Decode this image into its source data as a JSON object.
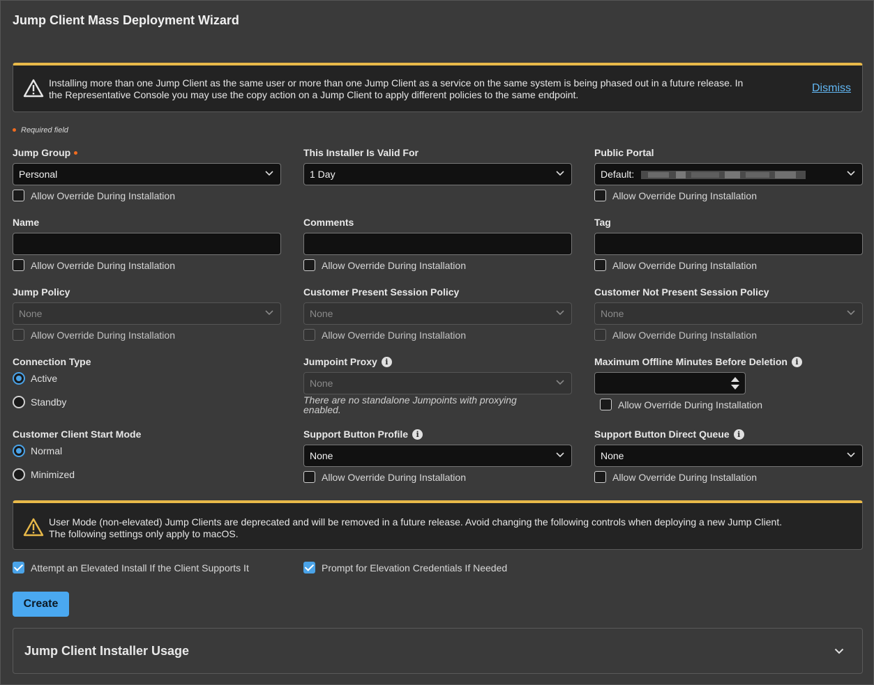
{
  "page": {
    "title": "Jump Client Mass Deployment Wizard"
  },
  "notices": {
    "top": {
      "line1": "Installing more than one Jump Client as the same user or more than one Jump Client as a service on the same system is being phased out in a future release. In",
      "line2": "the Representative Console you may use the copy action on a Jump Client to apply different policies to the same endpoint.",
      "dismiss": "Dismiss"
    },
    "bottom": {
      "line1": "User Mode (non-elevated) Jump Clients are deprecated and will be removed in a future release. Avoid changing the following controls when deploying a new Jump Client.",
      "line2": "The following settings only apply to macOS."
    }
  },
  "required_note": "Required field",
  "override_label": "Allow Override During Installation",
  "fields": {
    "jump_group": {
      "label": "Jump Group",
      "value": "Personal"
    },
    "valid_for": {
      "label": "This Installer Is Valid For",
      "value": "1 Day"
    },
    "public_portal": {
      "label": "Public Portal",
      "value": "Default:"
    },
    "name": {
      "label": "Name"
    },
    "comments": {
      "label": "Comments"
    },
    "tag": {
      "label": "Tag"
    },
    "jump_policy": {
      "label": "Jump Policy",
      "value": "None"
    },
    "present_policy": {
      "label": "Customer Present Session Policy",
      "value": "None"
    },
    "not_present_policy": {
      "label": "Customer Not Present Session Policy",
      "value": "None"
    },
    "connection_type": {
      "label": "Connection Type",
      "options": [
        "Active",
        "Standby"
      ],
      "selected": "Active"
    },
    "jumpoint_proxy": {
      "label": "Jumpoint Proxy",
      "value": "None",
      "hint_line1": "There are no standalone Jumpoints with proxying",
      "hint_line2": "enabled."
    },
    "max_offline": {
      "label": "Maximum Offline Minutes Before Deletion"
    },
    "start_mode": {
      "label": "Customer Client Start Mode",
      "options": [
        "Normal",
        "Minimized"
      ],
      "selected": "Normal"
    },
    "sb_profile": {
      "label": "Support Button Profile",
      "value": "None"
    },
    "sb_queue": {
      "label": "Support Button Direct Queue",
      "value": "None"
    }
  },
  "elevation": {
    "attempt_elevated": "Attempt an Elevated Install If the Client Supports It",
    "prompt_credentials": "Prompt for Elevation Credentials If Needed"
  },
  "create_label": "Create",
  "accordion_title": "Jump Client Installer Usage",
  "colors": {
    "accent": "#4aa8f0",
    "warning": "#e8b949",
    "required": "#f06b1f"
  }
}
